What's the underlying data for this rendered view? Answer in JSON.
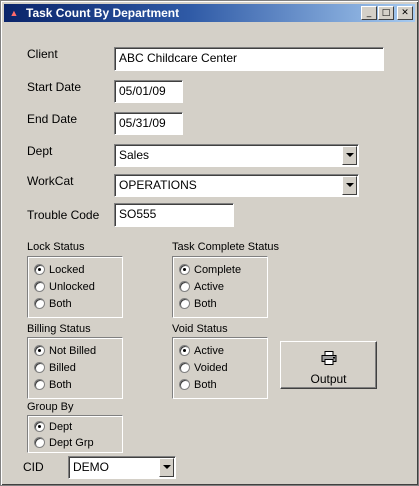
{
  "window": {
    "title": "Task Count By Department",
    "controls": {
      "minimize": "_",
      "maximize": "□",
      "close": "✕"
    }
  },
  "form": {
    "client": {
      "label": "Client",
      "value": "ABC Childcare Center"
    },
    "start_date": {
      "label": "Start Date",
      "value": "05/01/09"
    },
    "end_date": {
      "label": "End Date",
      "value": "05/31/09"
    },
    "dept": {
      "label": "Dept",
      "value": "Sales"
    },
    "workcat": {
      "label": "WorkCat",
      "value": "OPERATIONS"
    },
    "trouble_code": {
      "label": "Trouble Code",
      "value": "SO555"
    },
    "cid": {
      "label": "CID",
      "value": "DEMO"
    }
  },
  "groups": {
    "lock_status": {
      "label": "Lock Status",
      "options": [
        "Locked",
        "Unlocked",
        "Both"
      ],
      "selected": 0
    },
    "task_complete_status": {
      "label": "Task Complete Status",
      "options": [
        "Complete",
        "Active",
        "Both"
      ],
      "selected": 0
    },
    "billing_status": {
      "label": "Billing Status",
      "options": [
        "Not Billed",
        "Billed",
        "Both"
      ],
      "selected": 0
    },
    "void_status": {
      "label": "Void Status",
      "options": [
        "Active",
        "Voided",
        "Both"
      ],
      "selected": 0
    },
    "group_by": {
      "label": "Group By",
      "options": [
        "Dept",
        "Dept Grp"
      ],
      "selected": 0
    }
  },
  "buttons": {
    "output": "Output"
  },
  "icons": {
    "app": "app-icon",
    "output": "printer-icon"
  }
}
